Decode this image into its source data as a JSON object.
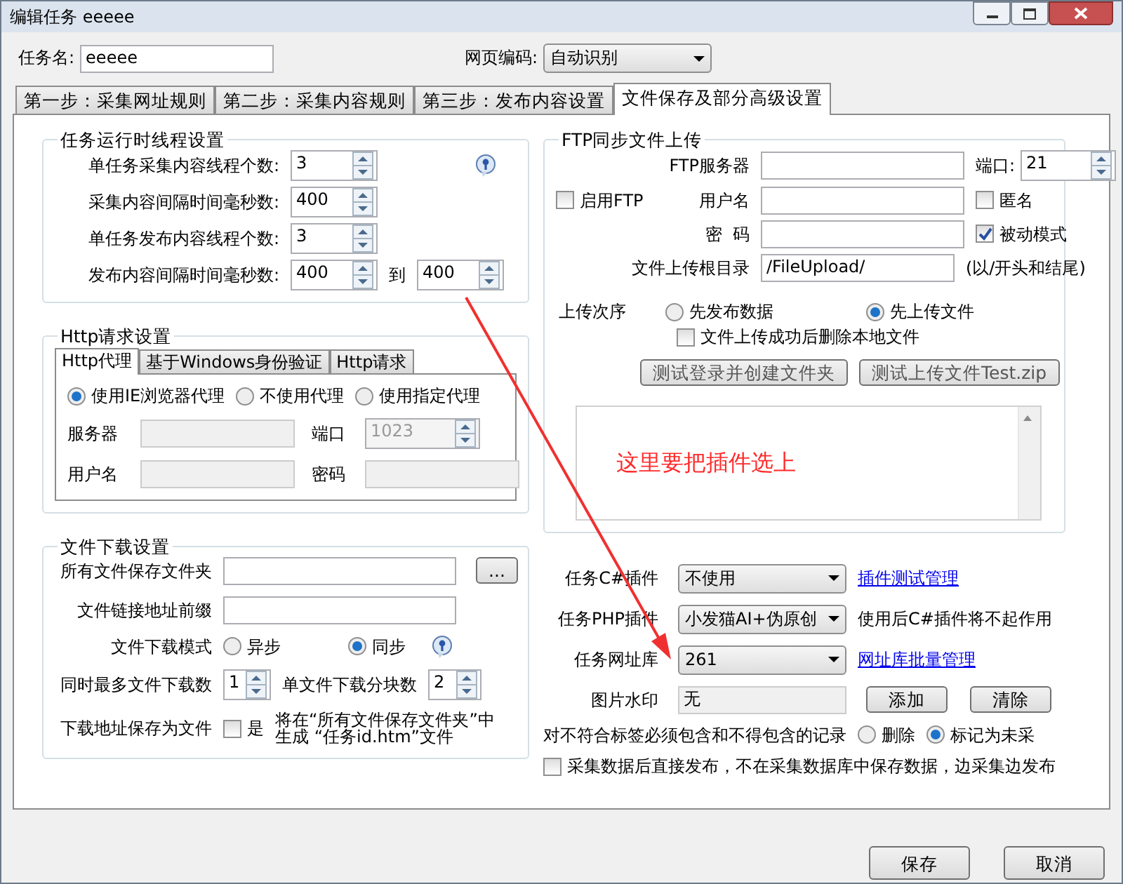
{
  "window": {
    "title": "编辑任务 eeeee"
  },
  "task_name": {
    "label": "任务名:",
    "value": "eeeee"
  },
  "encoding": {
    "label": "网页编码:",
    "value": "自动识别"
  },
  "tabs": [
    {
      "label": "第一步：采集网址规则",
      "selected": false
    },
    {
      "label": "第二步：采集内容规则",
      "selected": false
    },
    {
      "label": "第三步：发布内容设置",
      "selected": false
    },
    {
      "label": "文件保存及部分高级设置",
      "selected": true
    }
  ],
  "thread_settings": {
    "title": "任务运行时线程设置",
    "rows": [
      {
        "label": "单任务采集内容线程个数:",
        "value": "3"
      },
      {
        "label": "采集内容间隔时间毫秒数:",
        "value": "400"
      },
      {
        "label": "单任务发布内容线程个数:",
        "value": "3"
      },
      {
        "label": "发布内容间隔时间毫秒数:",
        "value": "400",
        "separator": "到",
        "value2": "400"
      }
    ]
  },
  "http_settings": {
    "title": "Http请求设置",
    "tabs": [
      {
        "label": "Http代理",
        "selected": true
      },
      {
        "label": "基于Windows身份验证",
        "selected": false
      },
      {
        "label": "Http请求",
        "selected": false
      }
    ],
    "proxy_options": [
      {
        "label": "使用IE浏览器代理",
        "selected": true
      },
      {
        "label": "不使用代理",
        "selected": false
      },
      {
        "label": "使用指定代理",
        "selected": false
      }
    ],
    "server_label": "服务器",
    "port_label": "端口",
    "port_value": "1023",
    "user_label": "用户名",
    "password_label": "密码"
  },
  "download_settings": {
    "title": "文件下载设置",
    "folder_label": "所有文件保存文件夹",
    "browse_button": "...",
    "prefix_label": "文件链接地址前缀",
    "mode_label": "文件下载模式",
    "mode_options": [
      {
        "label": "异步",
        "selected": false
      },
      {
        "label": "同步",
        "selected": true
      }
    ],
    "max_label": "同时最多文件下载数",
    "max_value": "1",
    "chunk_label": "单文件下载分块数",
    "chunk_value": "2",
    "save_label": "下载地址保存为文件",
    "save_checkbox": {
      "label": "是",
      "checked": false
    },
    "save_note": [
      "将在“所有文件保存文件夹”中",
      "生成 “任务id.htm”文件"
    ]
  },
  "ftp": {
    "title": "FTP同步文件上传",
    "server_label": "FTP服务器",
    "port_label": "端口:",
    "port_value": "21",
    "enable": {
      "label": "启用FTP",
      "checked": false
    },
    "user_label": "用户名",
    "anonymous": {
      "label": "匿名",
      "checked": false
    },
    "password_label": "密  码",
    "passive": {
      "label": "被动模式",
      "checked": true
    },
    "root_label": "文件上传根目录",
    "root_value": "/FileUpload/",
    "root_hint": "(以/开头和结尾)",
    "order_label": "上传次序",
    "order_options": [
      {
        "label": "先发布数据",
        "selected": false
      },
      {
        "label": "先上传文件",
        "selected": true
      }
    ],
    "delete_local": {
      "label": "文件上传成功后删除本地文件",
      "checked": false
    },
    "buttons": [
      "测试登录并创建文件夹",
      "测试上传文件Test.zip"
    ]
  },
  "annotation": {
    "text": "这里要把插件选上"
  },
  "plugins": {
    "csharp": {
      "label": "任务C#插件",
      "value": "不使用",
      "link": "插件测试管理"
    },
    "php": {
      "label": "任务PHP插件",
      "value": "小发猫AI+伪原创",
      "note": "使用后C#插件将不起作用"
    },
    "url_lib": {
      "label": "任务网址库",
      "value": "261",
      "link": "网址库批量管理"
    },
    "watermark": {
      "label": "图片水印",
      "value": "无",
      "buttons": [
        "添加",
        "清除"
      ]
    },
    "filter": {
      "label": "对不符合标签必须包含和不得包含的记录",
      "options": [
        {
          "label": "删除",
          "selected": false
        },
        {
          "label": "标记为未采",
          "selected": true
        }
      ]
    },
    "direct_publish": {
      "label": "采集数据后直接发布，不在采集数据库中保存数据，边采集边发布",
      "checked": false
    }
  },
  "buttons": [
    "保存",
    "取消"
  ]
}
